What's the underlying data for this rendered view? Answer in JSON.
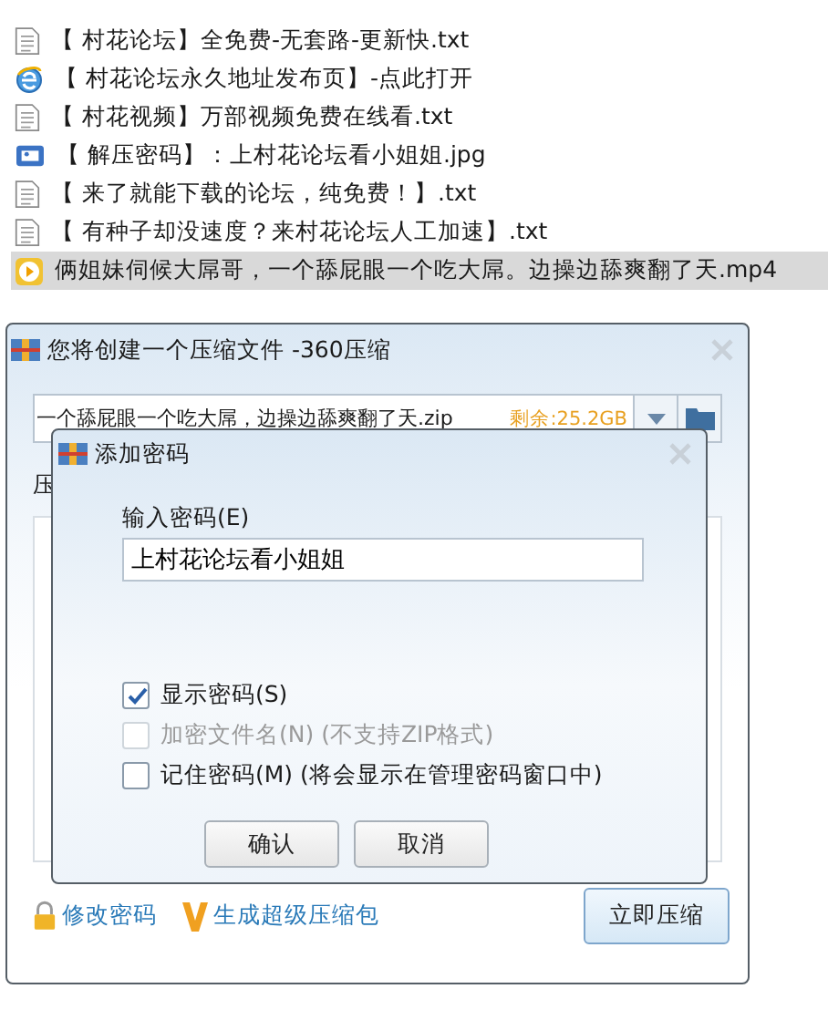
{
  "files": [
    {
      "name": "【 村花论坛】全免费-无套路-更新快.txt",
      "kind": "txt",
      "selected": false
    },
    {
      "name": "【 村花论坛永久地址发布页】-点此打开",
      "kind": "web",
      "selected": false
    },
    {
      "name": "【 村花视频】万部视频免费在线看.txt",
      "kind": "txt",
      "selected": false
    },
    {
      "name": "【 解压密码】：上村花论坛看小姐姐.jpg",
      "kind": "jpg",
      "selected": false
    },
    {
      "name": "【 来了就能下载的论坛，纯免费！】.txt",
      "kind": "txt",
      "selected": false
    },
    {
      "name": "【 有种子却没速度？来村花论坛人工加速】.txt",
      "kind": "txt",
      "selected": false
    },
    {
      "name": "俩姐妹伺候大屌哥，一个舔屁眼一个吃大屌。边操边舔爽翻了天.mp4",
      "kind": "video",
      "selected": true
    }
  ],
  "compress_dialog": {
    "title": "您将创建一个压缩文件 -360压缩",
    "filename": "一个舔屁眼一个吃大屌，边操边舔爽翻了天.zip",
    "free_space": "剩余:25.2GB",
    "section_label": "压",
    "links": [
      {
        "label": "修改密码",
        "kind": "lock"
      },
      {
        "label": "生成超级压缩包",
        "kind": "v"
      }
    ],
    "compress_button": "立即压缩"
  },
  "password_dialog": {
    "title": "添加密码",
    "input_label": "输入密码(E)",
    "password": "上村花论坛看小姐姐",
    "options": [
      {
        "label": "显示密码(S)",
        "checked": true,
        "disabled": false
      },
      {
        "label": "加密文件名(N) (不支持ZIP格式)",
        "checked": false,
        "disabled": true
      },
      {
        "label": "记住密码(M) (将会显示在管理密码窗口中)",
        "checked": false,
        "disabled": false
      }
    ],
    "buttons": [
      "确认",
      "取消"
    ]
  }
}
